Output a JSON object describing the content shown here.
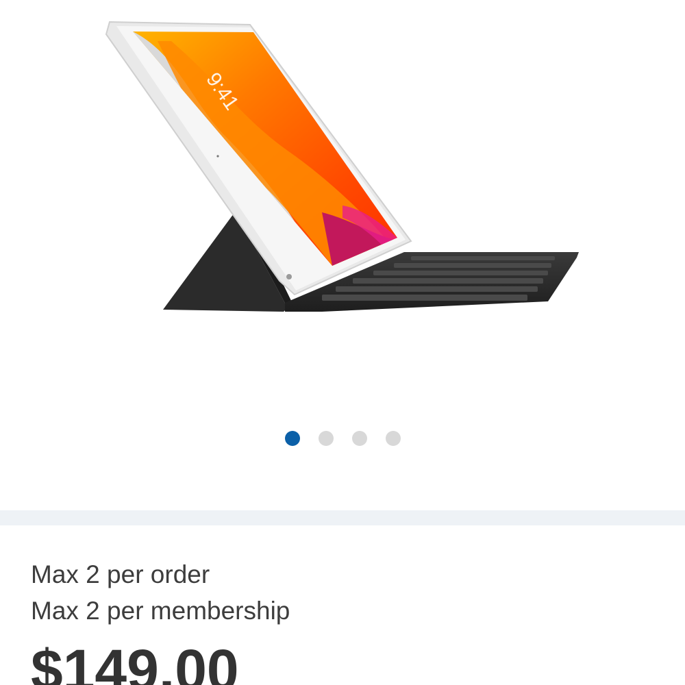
{
  "product": {
    "image_name": "ipad-smart-keyboard-product-image",
    "lockscreen_time": "9:41",
    "carousel": {
      "count": 4,
      "active_index": 0,
      "active_color": "#0b60a8",
      "inactive_color": "#d8d8d8"
    }
  },
  "limits": {
    "per_order": "Max 2 per order",
    "per_membership": "Max 2 per membership"
  },
  "pricing": {
    "price": "$149.00"
  },
  "colors": {
    "band": "#eef2f6",
    "text": "#3d3d3d"
  }
}
